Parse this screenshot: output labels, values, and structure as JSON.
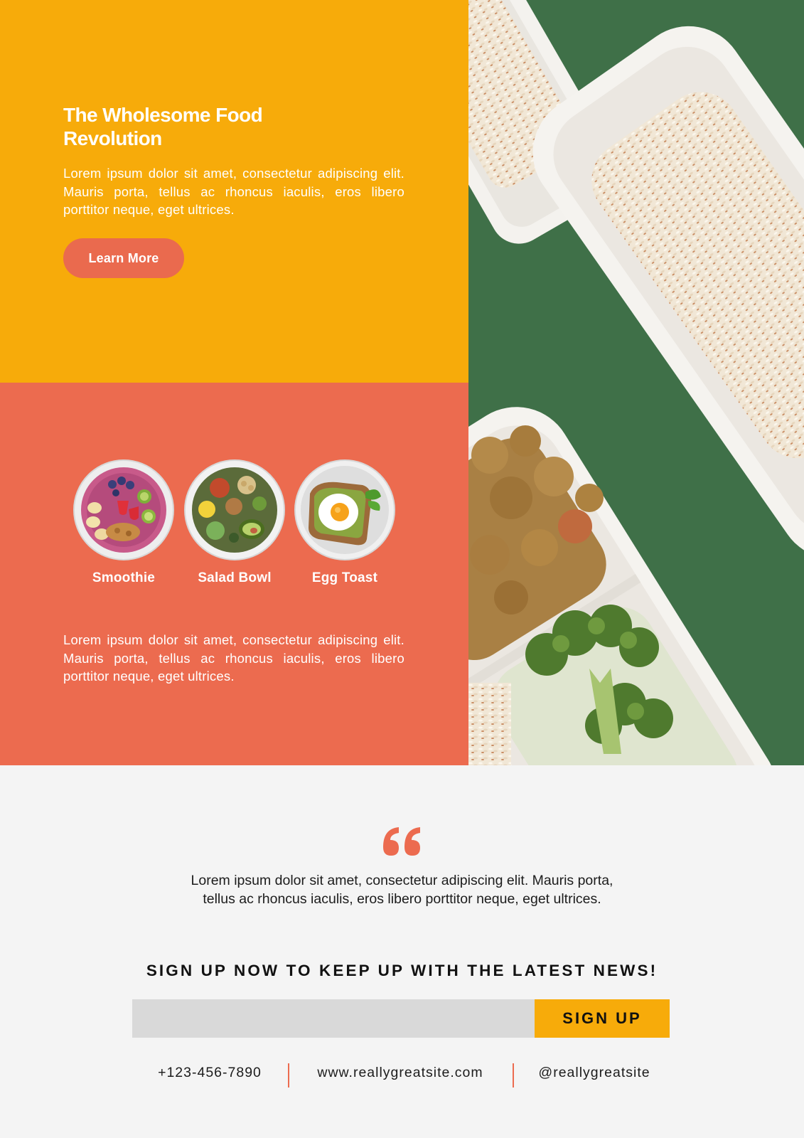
{
  "colors": {
    "yellow": "#f7ab0a",
    "coral": "#ec6b4f",
    "green": "#3f7048",
    "background": "#f4f4f4",
    "button_text": "#111111"
  },
  "hero": {
    "title_line1": "The Wholesome Food",
    "title_line2": "Revolution",
    "body": "Lorem ipsum dolor sit amet, consectetur adipiscing elit. Mauris porta, tellus ac rhoncus iaculis, eros libero porttitor neque, eget ultrices.",
    "cta_label": "Learn More"
  },
  "menu": {
    "items": [
      {
        "label": "Smoothie",
        "icon": "smoothie-bowl-icon"
      },
      {
        "label": "Salad Bowl",
        "icon": "salad-bowl-icon"
      },
      {
        "label": "Egg Toast",
        "icon": "egg-toast-icon"
      }
    ],
    "body": "Lorem ipsum dolor sit amet, consectetur adipiscing elit. Mauris porta, tellus ac rhoncus iaculis, eros libero porttitor neque, eget ultrices."
  },
  "testimonial": {
    "icon": "quote-icon",
    "line1": "Lorem ipsum dolor sit amet, consectetur adipiscing elit. Mauris porta,",
    "line2": "tellus ac rhoncus iaculis, eros libero porttitor neque, eget ultrices."
  },
  "signup": {
    "heading": "SIGN UP NOW TO KEEP UP WITH THE LATEST NEWS!",
    "email_value": "",
    "button_label": "SIGN UP"
  },
  "contact": {
    "phone": "+123-456-7890",
    "website": "www.reallygreatsite.com",
    "social": "@reallygreatsite"
  }
}
